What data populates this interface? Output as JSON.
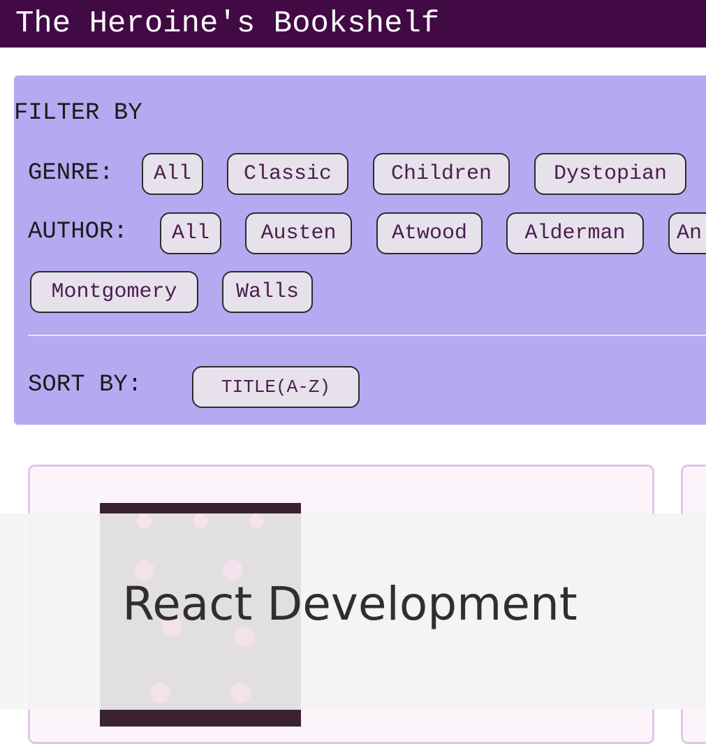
{
  "header": {
    "title": "The Heroine's Bookshelf"
  },
  "filters": {
    "heading": "FILTER BY",
    "genre": {
      "label": "GENRE:",
      "options": [
        "All",
        "Classic",
        "Children",
        "Dystopian"
      ]
    },
    "author": {
      "label": "AUTHOR:",
      "options": [
        "All",
        "Austen",
        "Atwood",
        "Alderman",
        "An",
        "Montgomery",
        "Walls"
      ]
    },
    "sort": {
      "label": "SORT BY:",
      "value": "TITLE(A-Z)"
    }
  },
  "overlay": {
    "text": "React Development"
  },
  "colors": {
    "header_bg": "#420a45",
    "filter_panel_bg": "#b5aaf1",
    "chip_bg": "#e7e1ec",
    "chip_text": "#4a1d4d",
    "card_border": "#e3c5e7",
    "cover_accent": "#b7175f"
  }
}
